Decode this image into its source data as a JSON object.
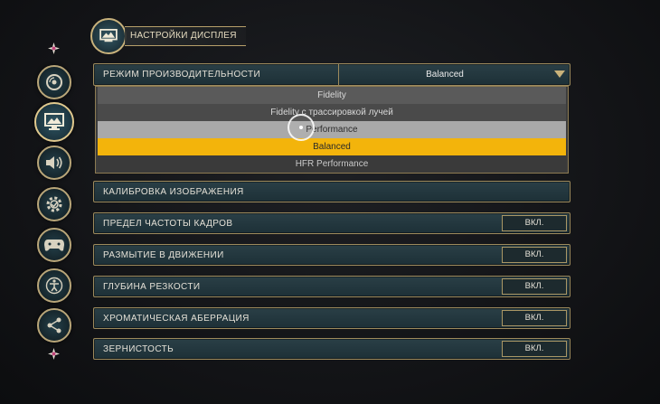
{
  "header": {
    "title": "НАСТРОЙКИ ДИСПЛЕЯ",
    "icon": "display-settings-icon"
  },
  "nav": {
    "items": [
      {
        "name": "disc-icon"
      },
      {
        "name": "display-icon",
        "active": true
      },
      {
        "name": "audio-icon"
      },
      {
        "name": "gameplay-gear-icon"
      },
      {
        "name": "controller-icon"
      },
      {
        "name": "accessibility-icon"
      },
      {
        "name": "share-icon"
      }
    ]
  },
  "performance": {
    "label": "РЕЖИМ ПРОИЗВОДИТЕЛЬНОСТИ",
    "value": "Balanced",
    "options": [
      "Fidelity",
      "Fidelity с трассировкой лучей",
      "Performance",
      "Balanced",
      "HFR Performance"
    ],
    "selected": "Balanced",
    "hovered": "Performance"
  },
  "settings": [
    {
      "label": "КАЛИБРОВКА ИЗОБРАЖЕНИЯ",
      "value": ""
    },
    {
      "label": "ПРЕДЕЛ ЧАСТОТЫ КАДРОВ",
      "value": "ВКЛ."
    },
    {
      "label": "РАЗМЫТИЕ В ДВИЖЕНИИ",
      "value": "ВКЛ."
    },
    {
      "label": "ГЛУБИНА РЕЗКОСТИ",
      "value": "ВКЛ."
    },
    {
      "label": "ХРОМАТИЧЕСКАЯ АБЕРРАЦИЯ",
      "value": "ВКЛ."
    },
    {
      "label": "ЗЕРНИСТОСТЬ",
      "value": "ВКЛ."
    }
  ],
  "colors": {
    "accent": "#f3b40b",
    "frame": "#9d8a5c",
    "row_bg": "#223840"
  }
}
